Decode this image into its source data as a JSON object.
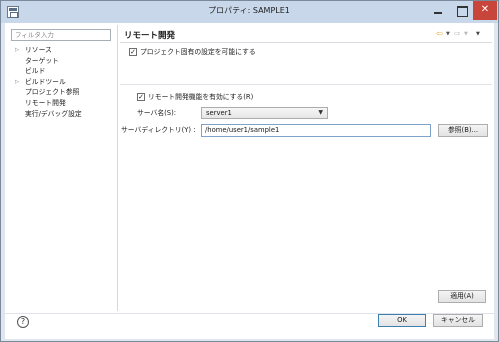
{
  "window": {
    "title": "プロパティ: SAMPLE1",
    "close_glyph": "✕"
  },
  "filter": {
    "placeholder": "フィルタ入力"
  },
  "tree": {
    "items": [
      {
        "label": "リソース",
        "expandable": true
      },
      {
        "label": "ターゲット",
        "expandable": false
      },
      {
        "label": "ビルド",
        "expandable": false
      },
      {
        "label": "ビルドツール",
        "expandable": true
      },
      {
        "label": "プロジェクト参照",
        "expandable": false
      },
      {
        "label": "リモート開発",
        "expandable": false,
        "selected": true
      },
      {
        "label": "実行/デバッグ設定",
        "expandable": false
      }
    ],
    "expand_glyph": "▷"
  },
  "page": {
    "title": "リモート開発",
    "nav": {
      "back": "⇦",
      "forward": "⇨",
      "dropdown": "▼"
    }
  },
  "settings": {
    "project_specific": {
      "label": "プロジェクト固有の設定を可能にする",
      "checked": true
    },
    "enable_remote": {
      "label": "リモート開発機能を有効にする(R)",
      "checked": true
    },
    "server_name": {
      "label": "サーバ名(S):",
      "value": "server1"
    },
    "server_dir": {
      "label": "サーバディレクトリ(Y) :",
      "value": "/home/user1/sample1"
    },
    "browse_label": "参照(B)...",
    "check_glyph": "✓",
    "dropdown_glyph": "▼"
  },
  "buttons": {
    "apply": "適用(A)",
    "ok": "OK",
    "cancel": "キャンセル",
    "help": "?"
  }
}
